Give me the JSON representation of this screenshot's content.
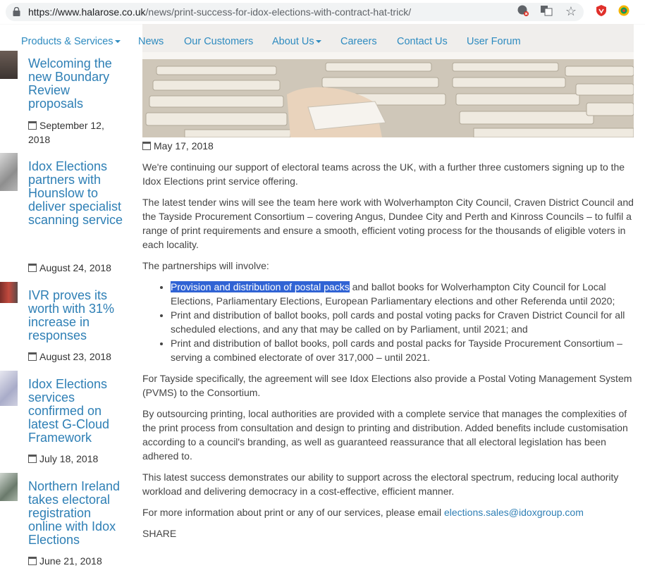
{
  "browser": {
    "url_host": "https://www.halarose.co.uk",
    "url_path": "/news/print-success-for-idox-elections-with-contract-hat-trick/"
  },
  "nav": {
    "items": [
      {
        "label": "Products & Services",
        "dropdown": true
      },
      {
        "label": "News",
        "dropdown": false
      },
      {
        "label": "Our Customers",
        "dropdown": false
      },
      {
        "label": "About Us",
        "dropdown": true
      },
      {
        "label": "Careers",
        "dropdown": false
      },
      {
        "label": "Contact Us",
        "dropdown": false
      },
      {
        "label": "User Forum",
        "dropdown": false
      }
    ]
  },
  "sidebar": {
    "items": [
      {
        "title": "Welcoming the new Boundary Review proposals",
        "date": "September 12, 2018"
      },
      {
        "title": "Idox Elections partners with Hounslow to deliver specialist scanning service",
        "date": "August 24, 2018"
      },
      {
        "title": "IVR proves its worth with 31% increase in responses",
        "date": "August 23, 2018"
      },
      {
        "title": "Idox Elections services confirmed on latest G-Cloud Framework",
        "date": "July 18, 2018"
      },
      {
        "title": "Northern Ireland takes electoral registration online with Idox Elections",
        "date": "June 21, 2018"
      }
    ]
  },
  "article": {
    "date": "May 17, 2018",
    "intro": "We're continuing our support of electoral teams across the UK, with a further three customers signing up to the Idox Elections print service offering.",
    "p2": "The latest tender wins will see the team here work with Wolverhampton City Council, Craven District Council and the Tayside Procurement Consortium – covering Angus, Dundee City and Perth and Kinross Councils – to fulfil a range of print requirements and ensure a smooth, efficient voting process for the thousands of eligible voters in each locality.",
    "p3": "The partnerships will involve:",
    "bullet1_highlight": "Provision and distribution of postal packs",
    "bullet1_rest": " and ballot books for Wolverhampton City Council for Local Elections, Parliamentary Elections, European Parliamentary elections and other Referenda until 2020;",
    "bullet2": "Print and distribution of ballot books, poll cards and postal voting packs for Craven District Council for all scheduled elections, and any that may be called on by Parliament, until 2021; and",
    "bullet3": "Print and distribution of ballot books, poll cards and postal packs for Tayside Procurement Consortium – serving a combined electorate of over 317,000 – until 2021.",
    "p4": "For Tayside specifically, the agreement will see Idox Elections also provide a Postal Voting Management System (PVMS) to the Consortium.",
    "p5": "By outsourcing printing, local authorities are provided with a complete service that manages the complexities of the print process from consultation and design to printing and distribution. Added benefits include customisation according to a council's branding, as well as guaranteed reassurance that all electoral legislation has been adhered to.",
    "p6": "This latest success demonstrates our ability to support across the electoral spectrum, reducing local authority workload and delivering democracy in a cost-effective, efficient manner.",
    "p7_text": "For more information about print or any of our services, please email ",
    "p7_email": "elections.sales@idoxgroup.com",
    "share": "SHARE"
  },
  "colors": {
    "link": "#2e7fb5",
    "nav": "#2e8bc0",
    "highlight": "#3063d4"
  }
}
